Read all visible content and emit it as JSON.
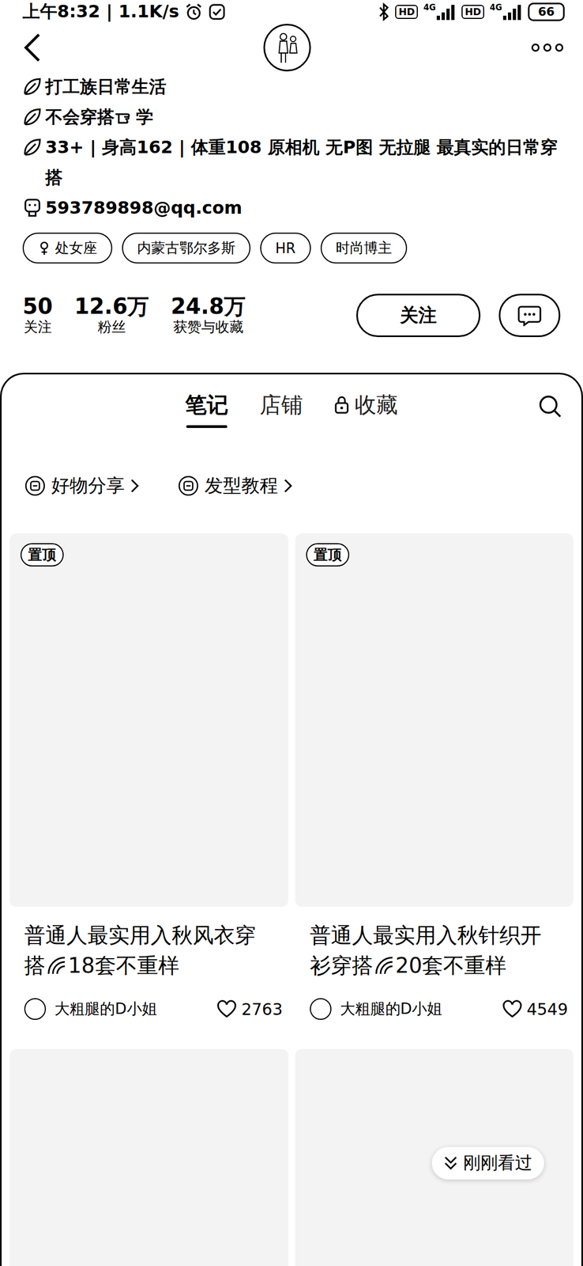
{
  "status_bar": {
    "left": "上午8:32 | 1.1K/s",
    "networks": [
      {
        "hd": "HD",
        "type": "4G"
      },
      {
        "hd": "HD",
        "type": "4G"
      }
    ],
    "battery": "66"
  },
  "profile": {
    "bio": [
      {
        "parts": [
          "打工族日常生活"
        ]
      },
      {
        "parts": [
          "不会穿搭",
          "学"
        ]
      },
      {
        "parts": [
          "33+ | 身高162 | 体重108 原相机 无P图 无拉腿 最真实的日常穿搭"
        ]
      }
    ],
    "email": "593789898@qq.com",
    "tags": [
      {
        "label": "处女座",
        "kind": "zodiac"
      },
      {
        "label": "内蒙古鄂尔多斯",
        "kind": "plain"
      },
      {
        "label": "HR",
        "kind": "plain"
      },
      {
        "label": "时尚博主",
        "kind": "plain"
      }
    ],
    "stats": [
      {
        "value": "50",
        "label": "关注"
      },
      {
        "value": "12.6万",
        "label": "粉丝"
      },
      {
        "value": "24.8万",
        "label": "获赞与收藏"
      }
    ],
    "follow_button": "关注"
  },
  "tabs": [
    {
      "label": "笔记",
      "selected": true,
      "locked": false
    },
    {
      "label": "店铺",
      "selected": false,
      "locked": false
    },
    {
      "label": "收藏",
      "selected": false,
      "locked": true
    }
  ],
  "collections": [
    {
      "label": "好物分享"
    },
    {
      "label": "发型教程"
    }
  ],
  "notes": [
    {
      "pinned": true,
      "badge": "置顶",
      "title_parts": [
        "普通人最实用入秋风衣穿搭",
        "18套不重样"
      ],
      "author": "大粗腿的D小姐",
      "likes": "2763"
    },
    {
      "pinned": true,
      "badge": "置顶",
      "title_parts": [
        "普通人最实用入秋针织开衫穿搭",
        "20套不重样"
      ],
      "author": "大粗腿的D小姐",
      "likes": "4549"
    },
    {
      "pinned": false
    },
    {
      "pinned": false
    }
  ],
  "recent": "刚刚看过"
}
